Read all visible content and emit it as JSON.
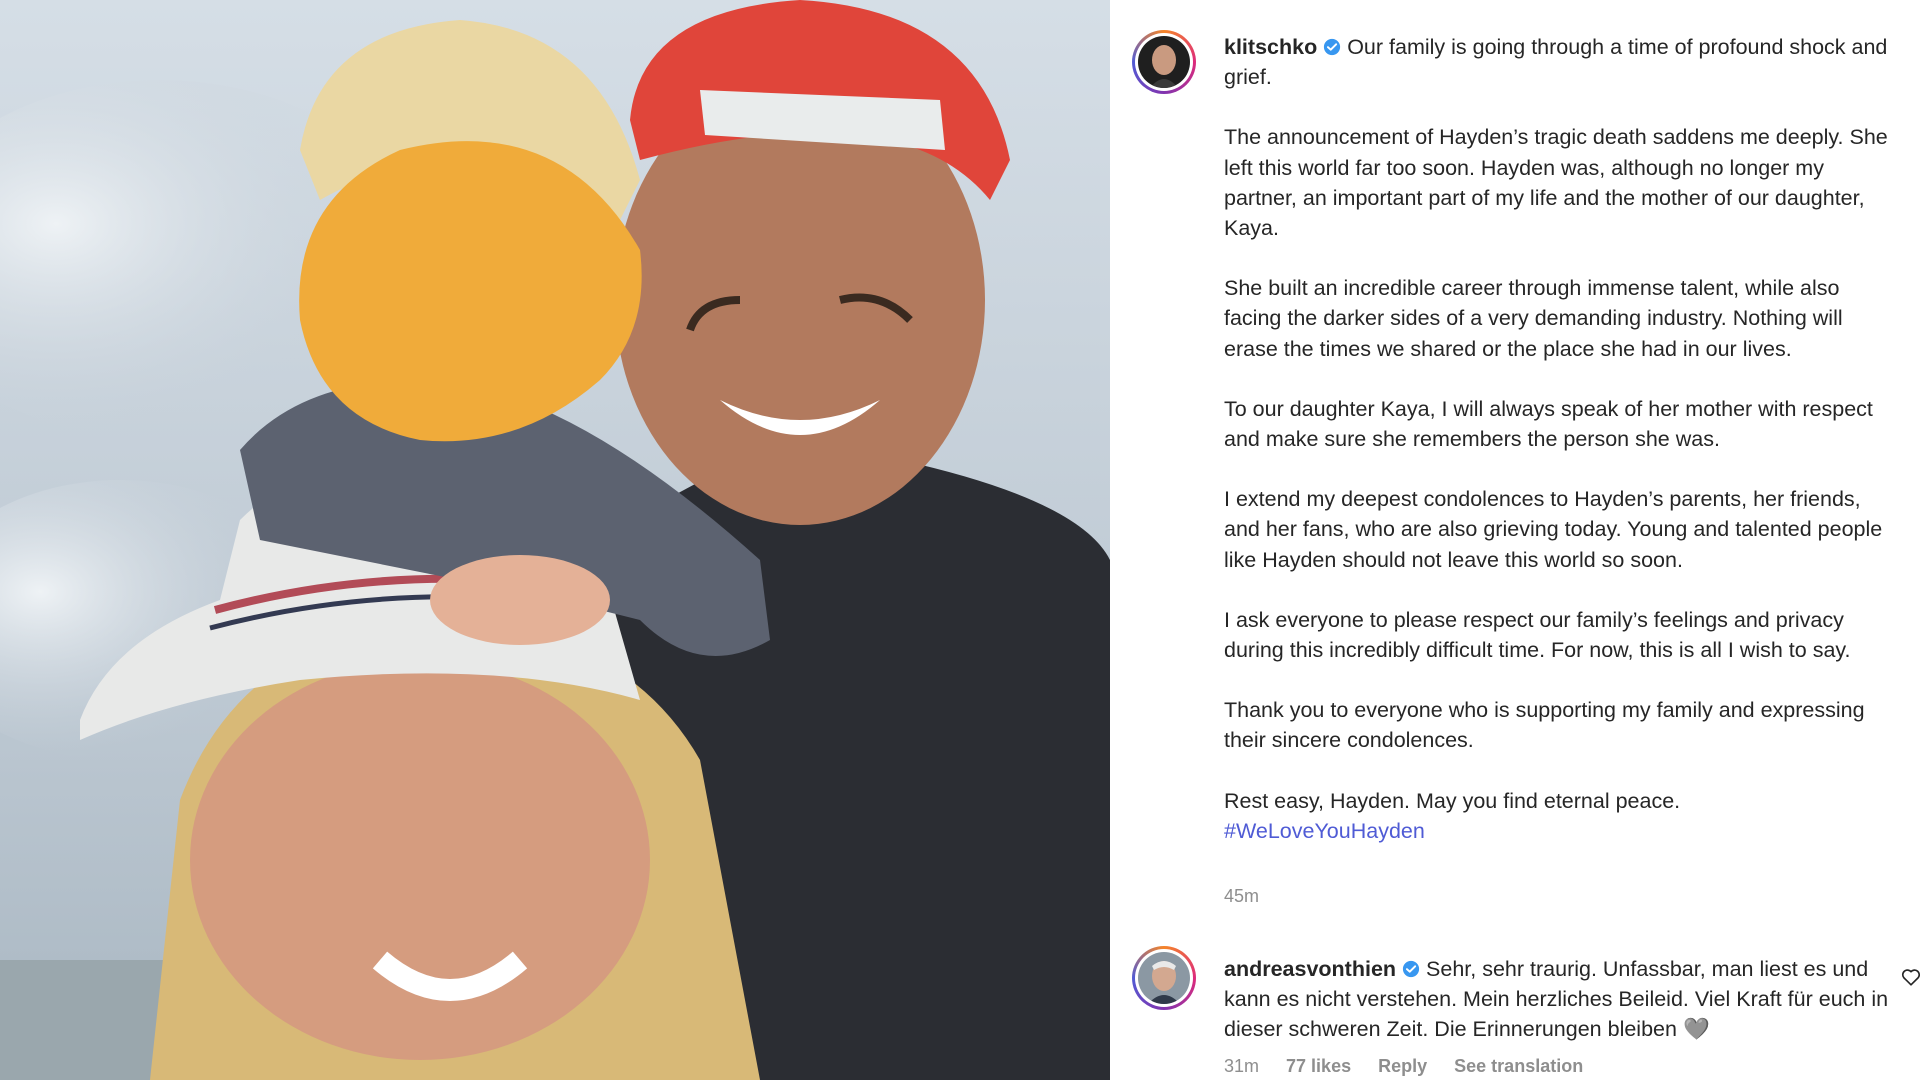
{
  "post": {
    "username": "klitschko",
    "verified": true,
    "caption_first": "Our family is going through a time of profound shock and grief.",
    "paragraphs": [
      "The announcement of Hayden’s tragic death saddens me deeply. She left this world far too soon. Hayden was, although no longer my partner, an important part of my life and the mother of our daughter, Kaya.",
      "She built an incredible career through immense talent, while also facing the darker sides of a very demanding industry. Nothing will erase the times we shared or the place she had in our lives.",
      "To our daughter Kaya, I will always speak of her mother with respect and make sure she remembers the person she was.",
      "I extend my deepest condolences to Hayden’s parents, her friends, and her fans, who are also grieving today. Young and talented people like Hayden should not leave this world so soon.",
      "I ask everyone to please respect our family’s feelings and privacy during this incredibly difficult time. For now, this is all I wish to say.",
      "Thank you to everyone who is supporting my family and expressing their sincere condolences.",
      "Rest easy, Hayden. May you find eternal peace."
    ],
    "hashtag": "#WeLoveYouHayden",
    "timestamp": "45m"
  },
  "comment": {
    "username": "andreasvonthien",
    "verified": true,
    "text": "Sehr, sehr traurig. Unfassbar, man liest es und kann es nicht verstehen. Mein herzliches Beileid. Viel Kraft für euch in dieser schweren Zeit. Die Erinnerungen bleiben",
    "emoji": "🩶",
    "time": "31m",
    "likes": "77 likes",
    "reply": "Reply",
    "see_translation": "See translation"
  },
  "colors": {
    "verified": "#3897f0",
    "hashtag": "#4f5bd5",
    "muted": "#8e8e8e"
  },
  "icons": {
    "verified": "verified-badge-icon",
    "heart": "heart-outline-icon"
  }
}
